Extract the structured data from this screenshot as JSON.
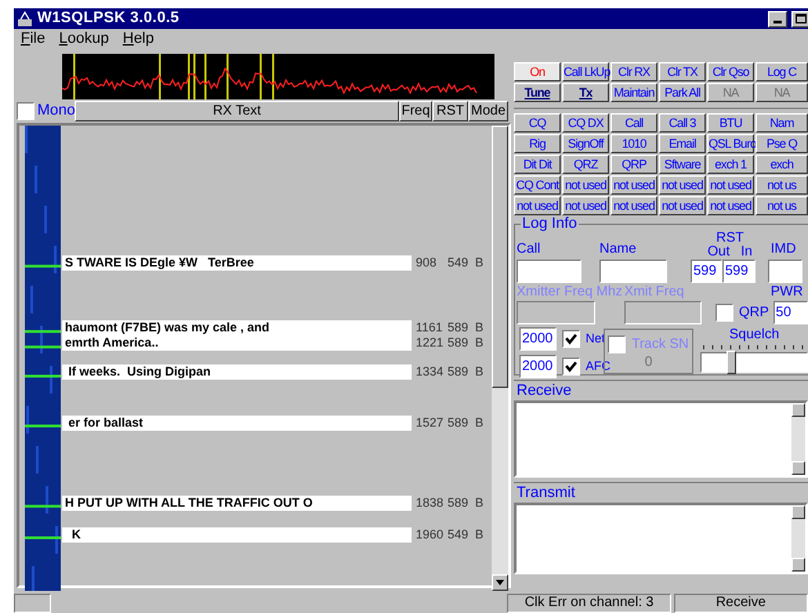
{
  "window": {
    "title": "W1SQLPSK 3.0.0.5"
  },
  "menu": [
    "File",
    "Lookup",
    "Help"
  ],
  "mono": {
    "label": "Mono",
    "checked": false
  },
  "columns": [
    "RX Text",
    "Freq",
    "RST",
    "Mode"
  ],
  "channels": [
    {
      "text": "S TWARE IS DEgle ¥W   TerBree",
      "freq": "908",
      "rst": "549",
      "mode": "B"
    },
    {
      "text": "haumont (F7BE) was my cale , and",
      "freq": "1161",
      "rst": "589",
      "mode": "B"
    },
    {
      "text": "emrth America..",
      "freq": "1221",
      "rst": "589",
      "mode": "B"
    },
    {
      "text": " If weeks.  Using Digipan",
      "freq": "1334",
      "rst": "589",
      "mode": "B"
    },
    {
      "text": " er for ballast",
      "freq": "1527",
      "rst": "589",
      "mode": "B"
    },
    {
      "text": "H PUT UP WITH ALL THE TRAFFIC OUT O",
      "freq": "1838",
      "rst": "589",
      "mode": "B"
    },
    {
      "text": "  K",
      "freq": "1960",
      "rst": "549",
      "mode": "B"
    }
  ],
  "control_buttons": [
    {
      "label": "On",
      "kind": "alert",
      "disabled": false
    },
    {
      "label": "Call LkUp",
      "kind": "macro",
      "disabled": false
    },
    {
      "label": "Clr RX",
      "kind": "macro",
      "disabled": false
    },
    {
      "label": "Clr TX",
      "kind": "macro",
      "disabled": false
    },
    {
      "label": "Clr Qso",
      "kind": "macro",
      "disabled": false
    },
    {
      "label": "Log C",
      "kind": "macro",
      "disabled": false
    },
    {
      "label": "Tune",
      "kind": "toggle",
      "disabled": false
    },
    {
      "label": "Tx",
      "kind": "toggle",
      "disabled": false
    },
    {
      "label": "Maintain",
      "kind": "macro",
      "disabled": false
    },
    {
      "label": "Park All",
      "kind": "macro",
      "disabled": false
    },
    {
      "label": "NA",
      "kind": "macro",
      "disabled": true
    },
    {
      "label": "NA",
      "kind": "macro",
      "disabled": true
    }
  ],
  "macro_buttons": [
    {
      "label": "CQ",
      "disabled": false
    },
    {
      "label": "CQ DX",
      "disabled": false
    },
    {
      "label": "Call",
      "disabled": false
    },
    {
      "label": "Call 3",
      "disabled": false
    },
    {
      "label": "BTU",
      "disabled": false
    },
    {
      "label": "Nam",
      "disabled": false
    },
    {
      "label": "Rig",
      "disabled": false
    },
    {
      "label": "SignOff",
      "disabled": false
    },
    {
      "label": "1010",
      "disabled": false
    },
    {
      "label": "Email",
      "disabled": false
    },
    {
      "label": "QSL Buro",
      "disabled": false
    },
    {
      "label": "Pse Q",
      "disabled": false
    },
    {
      "label": "Dit Dit",
      "disabled": false
    },
    {
      "label": "QRZ",
      "disabled": false
    },
    {
      "label": "QRP",
      "disabled": false
    },
    {
      "label": "Sftware",
      "disabled": false
    },
    {
      "label": "exch 1",
      "disabled": false
    },
    {
      "label": "exch",
      "disabled": false
    },
    {
      "label": "CQ Cont",
      "disabled": false
    },
    {
      "label": "not used",
      "disabled": false
    },
    {
      "label": "not used",
      "disabled": false
    },
    {
      "label": "not used",
      "disabled": false
    },
    {
      "label": "not used",
      "disabled": false
    },
    {
      "label": "not us",
      "disabled": false
    },
    {
      "label": "not used",
      "disabled": false
    },
    {
      "label": "not used",
      "disabled": false
    },
    {
      "label": "not used",
      "disabled": false
    },
    {
      "label": "not used",
      "disabled": false
    },
    {
      "label": "not used",
      "disabled": false
    },
    {
      "label": "not us",
      "disabled": false
    }
  ],
  "log_info": {
    "title": "Log Info",
    "call": {
      "label": "Call"
    },
    "name": {
      "label": "Name"
    },
    "rst": {
      "label": "RST",
      "out_label": "Out",
      "in_label": "In",
      "out": "599",
      "in": "599"
    },
    "imd": {
      "label": "IMD"
    },
    "xmitter_freq": {
      "label": "Xmitter Freq Mhz",
      "disabled": true
    },
    "xmit_freq": {
      "label": "Xmit Freq",
      "disabled": true
    },
    "qrp": {
      "label": "QRP",
      "checked": false
    },
    "pwr": {
      "label": "PWR",
      "value": "50"
    },
    "net": {
      "value": "2000",
      "label": "Net",
      "checked": true
    },
    "afc": {
      "value": "2000",
      "label": "AFC",
      "checked": true
    },
    "track_sn": {
      "label": "Track SN",
      "checked": false,
      "value": "0"
    },
    "squelch": {
      "label": "Squelch",
      "level": 0.25
    }
  },
  "receive": {
    "label": "Receive"
  },
  "transmit": {
    "label": "Transmit"
  },
  "status_bar": {
    "message": "Clk Err on channel: 3",
    "mode": "Receive"
  }
}
